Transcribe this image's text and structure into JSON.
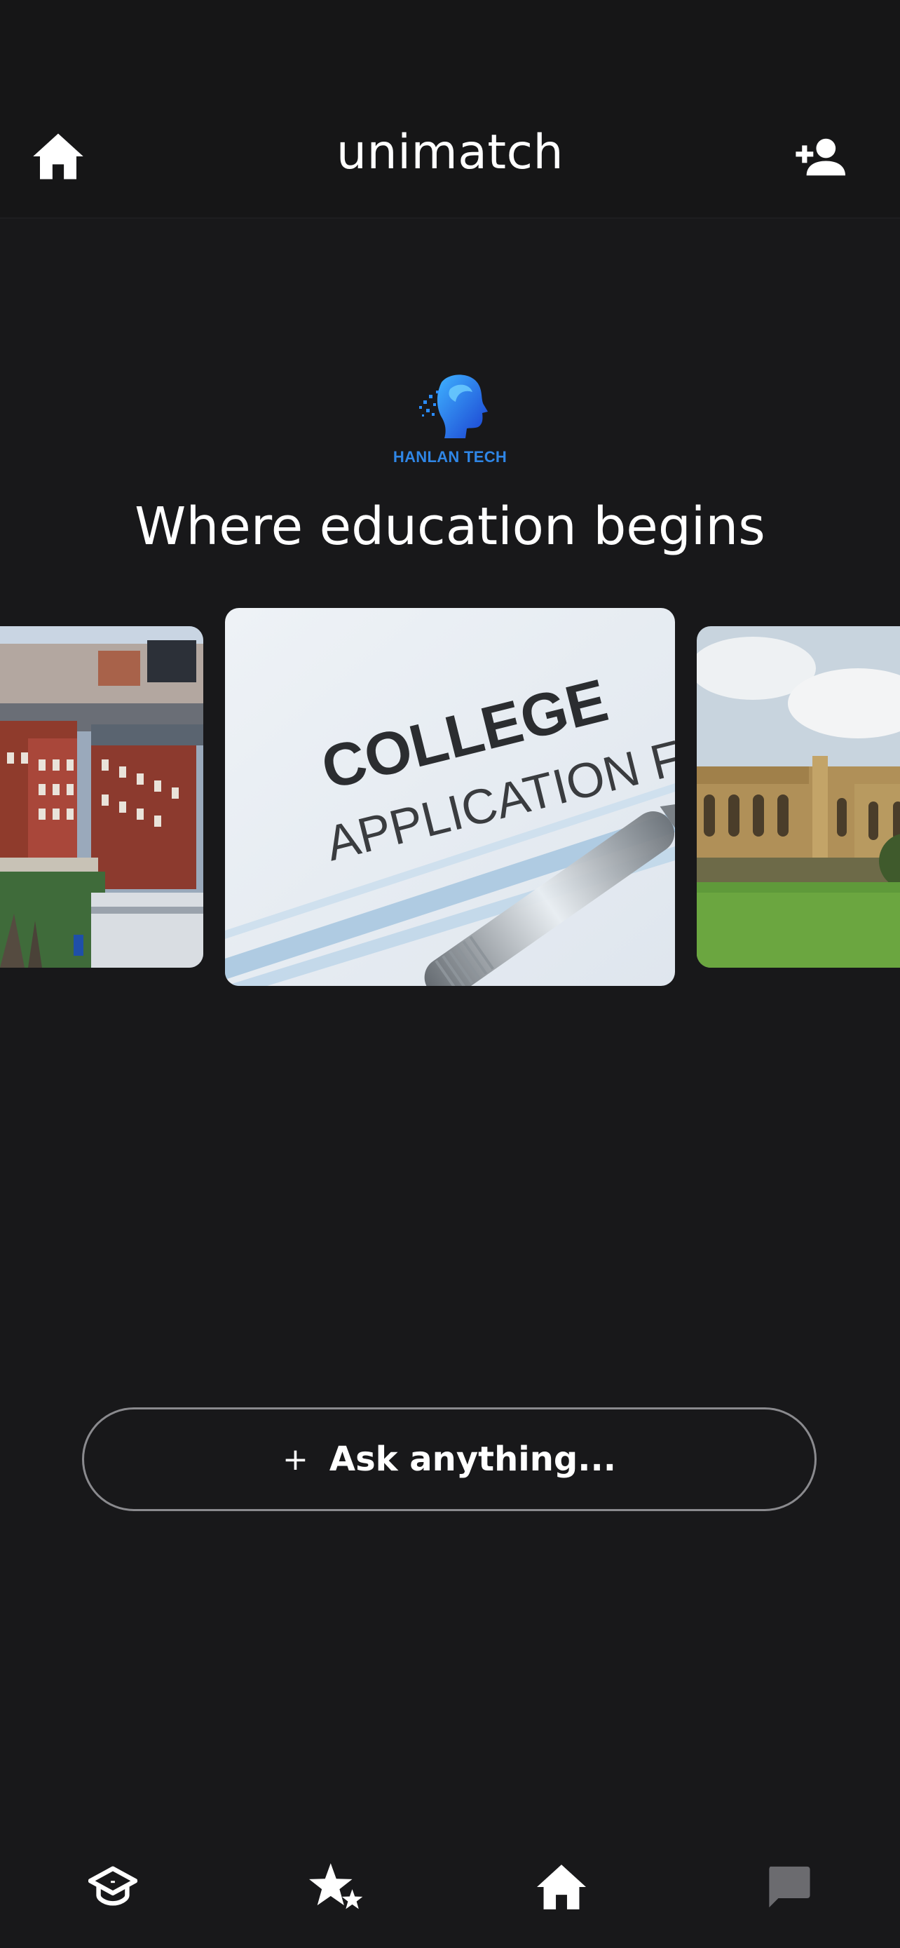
{
  "header": {
    "title": "unimatch",
    "home_icon": "home-icon",
    "add_user_icon": "person-add-icon"
  },
  "logo": {
    "text": "HANLAN TECH",
    "color": "#2f86e6"
  },
  "tagline": "Where education begins",
  "carousel": {
    "cards": [
      {
        "name": "campus-brick-buildings",
        "description_icon": "photo"
      },
      {
        "name": "college-application-form",
        "line1": "COLLEGE",
        "line2": "APPLICATION FOR"
      },
      {
        "name": "gothic-college-lawn",
        "description_icon": "photo"
      }
    ]
  },
  "ask": {
    "plus": "+",
    "placeholder": "Ask anything..."
  },
  "bottom_nav": {
    "items": [
      {
        "icon": "graduation-cap-icon",
        "active": false
      },
      {
        "icon": "stars-icon",
        "active": false
      },
      {
        "icon": "home-icon",
        "active": true
      },
      {
        "icon": "chat-bubble-icon",
        "active": false
      }
    ]
  },
  "colors": {
    "background": "#18181a",
    "header_bg": "#161617",
    "inactive_icon": "#6b6b6f",
    "ask_border": "#8a8a8e"
  }
}
